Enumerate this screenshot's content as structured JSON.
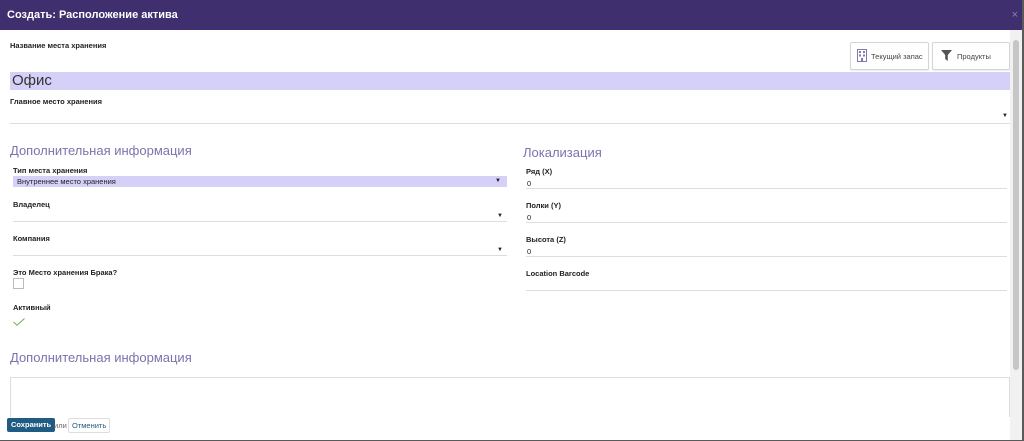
{
  "dialog": {
    "title": "Создать: Расположение актива",
    "close_glyph": "×"
  },
  "header_buttons": {
    "current_stock": "Текущий запас",
    "products": "Продукты"
  },
  "form": {
    "name_label": "Название места хранения",
    "name_value": "Офис",
    "parent_label": "Главное место хранения",
    "parent_value": ""
  },
  "additional": {
    "heading": "Дополнительная информация",
    "type_label": "Тип места хранения",
    "type_value": "Внутреннее место хранения",
    "owner_label": "Владелец",
    "company_label": "Компания",
    "scrap_label": "Это Место хранения Брака?",
    "active_label": "Активный"
  },
  "localization": {
    "heading": "Локализация",
    "row_label": "Ряд (X)",
    "row_value": "0",
    "shelf_label": "Полки (Y)",
    "shelf_value": "0",
    "height_label": "Высота (Z)",
    "height_value": "0",
    "barcode_label": "Location Barcode"
  },
  "notes": {
    "heading": "Дополнительная информация"
  },
  "footer": {
    "save": "Сохранить",
    "or": "или",
    "cancel": "Отменить"
  },
  "colors": {
    "titlebar": "#3f2f6e",
    "accent_heading": "#7a73ad",
    "highlight_field": "#d4d0f7",
    "save_button": "#1f5b82",
    "check": "#6ab04c"
  },
  "icons": {
    "current_stock": "building-icon",
    "products": "filter-icon",
    "active": "checkmark-icon"
  }
}
